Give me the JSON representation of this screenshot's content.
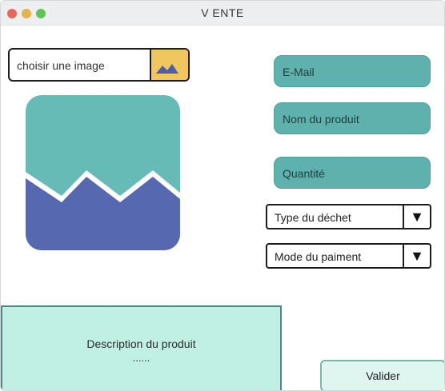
{
  "window": {
    "title": "V ENTE"
  },
  "image_picker": {
    "placeholder": "choisir une image",
    "icon": "image-icon"
  },
  "fields": {
    "email": "E-Mail",
    "product_name": "Nom du produit",
    "quantity": "Quantité"
  },
  "selects": {
    "waste_type": "Type du déchet",
    "payment_mode": "Mode du paiment",
    "arrow": "▼"
  },
  "description": {
    "label": "Description du produit",
    "ellipsis": "......"
  },
  "submit": {
    "label": "Valider"
  },
  "colors": {
    "field_teal": "#5fb1ae",
    "picker_yellow": "#f0c75e",
    "preview_teal": "#66bbb6",
    "preview_blue": "#5568b0",
    "description_bg": "#bff0e3",
    "button_bg": "#dff6f0"
  }
}
